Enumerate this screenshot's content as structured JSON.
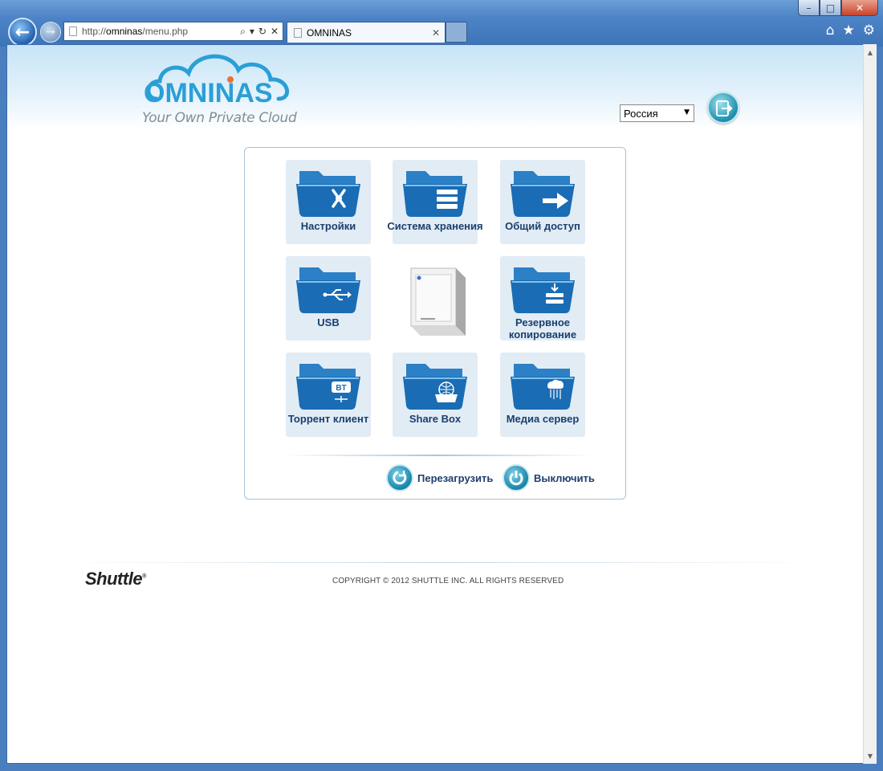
{
  "browser": {
    "url_prefix": "http://",
    "url_host": "omninas",
    "url_path": "/menu.php",
    "tab_title": "OMNINAS",
    "tab_close": "✕",
    "window_controls": {
      "minimize": "–",
      "maximize": "□",
      "close": "✕"
    },
    "address_controls": {
      "search": "⌕",
      "dropdown": "▾",
      "refresh": "↻",
      "stop": "✕"
    },
    "tools": {
      "home": "⌂",
      "favorites": "★",
      "settings": "⚙"
    }
  },
  "header": {
    "brand": "OMNINAS",
    "tagline": "Your Own Private Cloud",
    "language": "Россия",
    "logout_icon": "logout-icon"
  },
  "menu": {
    "tiles": [
      {
        "label": "Настройки",
        "icon": "tools-icon"
      },
      {
        "label": "Система хранения",
        "icon": "storage-icon"
      },
      {
        "label": "Общий доступ",
        "icon": "share-arrow-icon"
      },
      {
        "label": "USB",
        "icon": "usb-icon"
      },
      {
        "label": "Резервное копирование",
        "icon": "backup-icon"
      },
      {
        "label": "Торрент клиент",
        "icon": "bt-icon"
      },
      {
        "label": "Share Box",
        "icon": "globe-box-icon"
      },
      {
        "label": "Медиа сервер",
        "icon": "media-cloud-icon"
      }
    ]
  },
  "power": {
    "reboot_label": "Перезагрузить",
    "shutdown_label": "Выключить"
  },
  "footer": {
    "brand": "Shuttle",
    "brand_mark": "®",
    "copyright": "COPYRIGHT © 2012 SHUTTLE INC. ALL RIGHTS RESERVED"
  },
  "colors": {
    "accent": "#1b3f6e",
    "folder": "#1a6cb4",
    "tile_bg": "#e1ecf5"
  }
}
